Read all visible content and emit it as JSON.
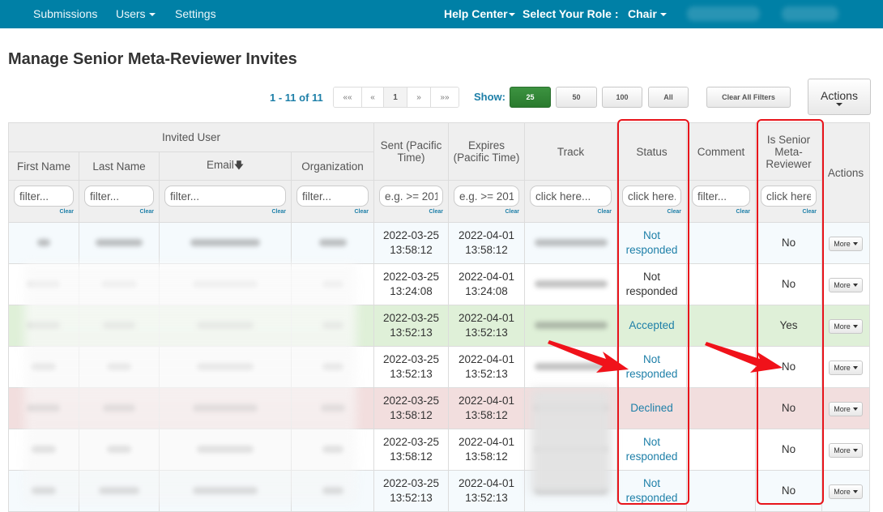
{
  "nav": {
    "left_items": [
      {
        "label": "Submissions",
        "has_caret": false
      },
      {
        "label": "Users",
        "has_caret": true
      },
      {
        "label": "Settings",
        "has_caret": false
      }
    ],
    "help_center": "Help Center",
    "role_label": "Select Your Role :",
    "role_value": "Chair",
    "bar_color": "#0080a6"
  },
  "page": {
    "title": "Manage Senior Meta-Reviewer Invites"
  },
  "toolbar": {
    "record_count": "1 - 11 of 11",
    "pager": [
      "««",
      "«",
      "1",
      "»",
      "»»"
    ],
    "current_page": "1",
    "show_label": "Show:",
    "page_sizes": [
      "25",
      "50",
      "100",
      "All"
    ],
    "selected_page_size": "25",
    "clear_filters": "Clear All Filters",
    "actions": "Actions"
  },
  "table": {
    "group_header": "Invited User",
    "columns": {
      "first_name": "First Name",
      "last_name": "Last Name",
      "email": "Email",
      "organization": "Organization",
      "sent": "Sent (Pacific Time)",
      "expires": "Expires (Pacific Time)",
      "track": "Track",
      "status": "Status",
      "comment": "Comment",
      "senior": "Is Senior Meta-Reviewer",
      "actions": "Actions"
    },
    "sort_indicator": "email-descending",
    "filters": {
      "first_name": "filter...",
      "last_name": "filter...",
      "email": "filter...",
      "organization": "filter...",
      "sent": "e.g. >= 201",
      "expires": "e.g. >= 201",
      "track": "click here...",
      "status": "click here...",
      "comment": "filter...",
      "senior": "click here..."
    },
    "clear_label": "Clear",
    "more_label": "More",
    "rows": [
      {
        "sent_date": "2022-03-25",
        "sent_time": "13:58:12",
        "exp_date": "2022-04-01",
        "exp_time": "13:58:12",
        "status_1": "Not",
        "status_2": "responded",
        "status_style": "link",
        "senior": "No",
        "tint": "blue"
      },
      {
        "sent_date": "2022-03-25",
        "sent_time": "13:24:08",
        "exp_date": "2022-04-01",
        "exp_time": "13:24:08",
        "status_1": "Not",
        "status_2": "responded",
        "status_style": "plain",
        "senior": "No",
        "tint": "white"
      },
      {
        "sent_date": "2022-03-25",
        "sent_time": "13:52:13",
        "exp_date": "2022-04-01",
        "exp_time": "13:52:13",
        "status_1": "Accepted",
        "status_2": "",
        "status_style": "link",
        "senior": "Yes",
        "tint": "green"
      },
      {
        "sent_date": "2022-03-25",
        "sent_time": "13:52:13",
        "exp_date": "2022-04-01",
        "exp_time": "13:52:13",
        "status_1": "Not",
        "status_2": "responded",
        "status_style": "link",
        "senior": "No",
        "tint": "white"
      },
      {
        "sent_date": "2022-03-25",
        "sent_time": "13:58:12",
        "exp_date": "2022-04-01",
        "exp_time": "13:58:12",
        "status_1": "Declined",
        "status_2": "",
        "status_style": "link",
        "senior": "No",
        "tint": "red"
      },
      {
        "sent_date": "2022-03-25",
        "sent_time": "13:58:12",
        "exp_date": "2022-04-01",
        "exp_time": "13:58:12",
        "status_1": "Not",
        "status_2": "responded",
        "status_style": "link",
        "senior": "No",
        "tint": "white"
      },
      {
        "sent_date": "2022-03-25",
        "sent_time": "13:52:13",
        "exp_date": "2022-04-01",
        "exp_time": "13:52:13",
        "status_1": "Not",
        "status_2": "responded",
        "status_style": "link",
        "senior": "No",
        "tint": "blue"
      }
    ]
  },
  "annotations": {
    "highlight_color": "#e8141b",
    "highlighted_columns": [
      "Status",
      "Is Senior Meta-Reviewer"
    ]
  }
}
